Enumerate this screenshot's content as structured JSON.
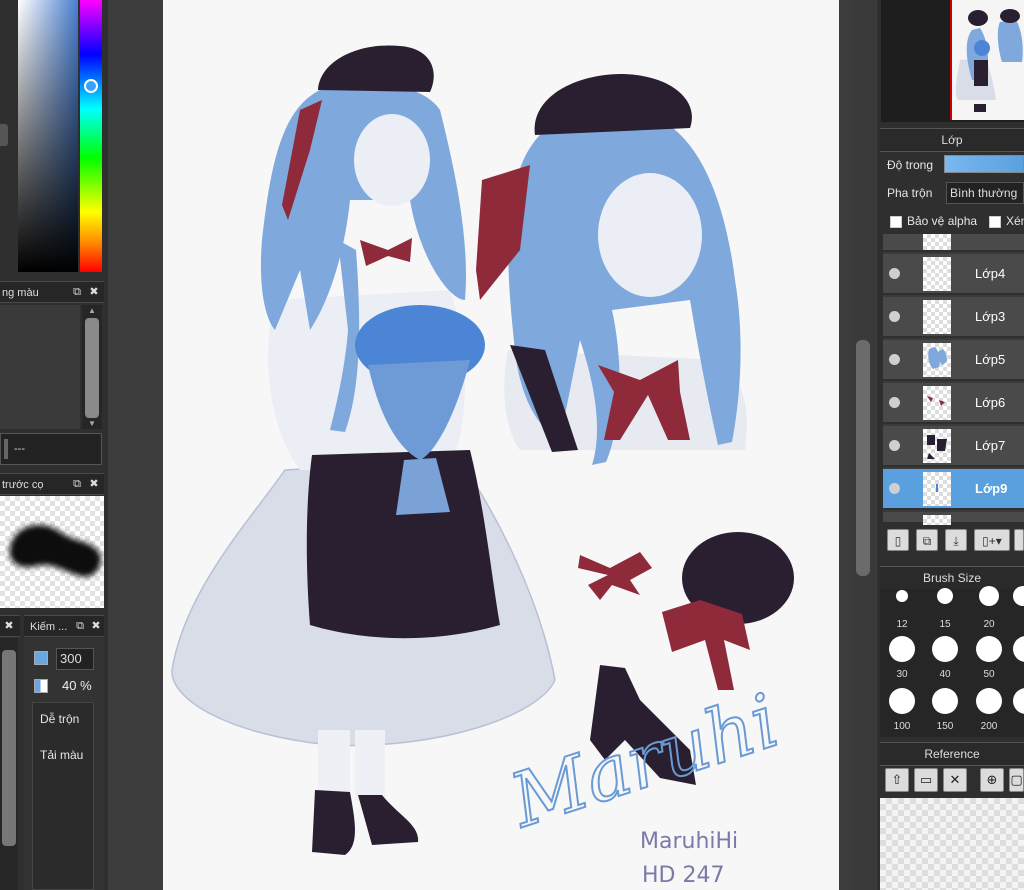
{
  "left_panel": {
    "color_sets_title": "ng màu",
    "color_value_text": "---",
    "brush_preview_title": "trước cọ",
    "brush_tab_title": "Kiếm ...",
    "brush_size_value": "300",
    "brush_opacity_value": "40 %",
    "option_blend": "Dễ trộn",
    "option_load_color": "Tải màu"
  },
  "artwork": {
    "signature": "Maruhi",
    "watermark_line1": "MaruhiHi",
    "watermark_line2": "HD 247"
  },
  "right_panel": {
    "layers_title": "Lớp",
    "opacity_label": "Độ trong",
    "blend_label": "Pha trộn",
    "blend_value": "Bình thường",
    "protect_alpha_label": "Bảo vệ alpha",
    "clipping_label": "Xén",
    "layers": [
      {
        "name": "Lớp4",
        "selected": false
      },
      {
        "name": "Lớp3",
        "selected": false
      },
      {
        "name": "Lớp5",
        "selected": false
      },
      {
        "name": "Lớp6",
        "selected": false
      },
      {
        "name": "Lớp7",
        "selected": false
      },
      {
        "name": "Lớp9",
        "selected": true
      }
    ],
    "brush_size_title": "Brush Size",
    "brush_sizes": [
      "12",
      "15",
      "20",
      "30",
      "40",
      "50",
      "100",
      "150",
      "200"
    ],
    "reference_title": "Reference"
  },
  "icons": {
    "new_layer": "new-layer-icon",
    "copy_layer": "copy-layer-icon",
    "merge_layer": "merge-layer-icon",
    "add_layer_menu": "add-layer-menu-icon",
    "folder": "folder-icon",
    "upload": "upload-icon",
    "open": "open-folder-icon",
    "close": "close-icon",
    "zoom_in": "zoom-in-icon",
    "fit": "fit-icon"
  },
  "colors": {
    "selected_layer": "#5aa0de",
    "panel_bg": "#2f2f2f",
    "canvas_bg": "#f7f7f8",
    "hair": "#7fa8dc",
    "ribbon": "#8e2a3a",
    "dark": "#2a1f30"
  }
}
